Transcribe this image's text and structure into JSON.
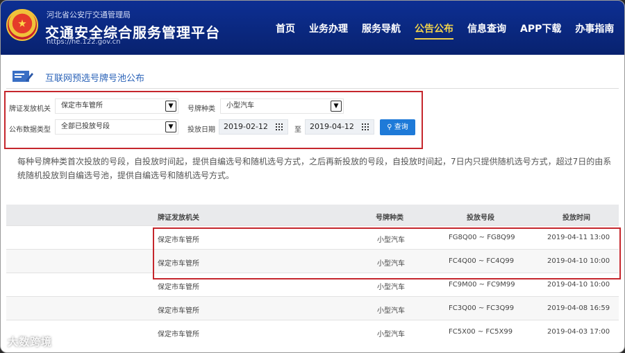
{
  "header": {
    "org_name": "河北省公安厅交通管理局",
    "site_title": "交通安全综合服务管理平台",
    "site_url": "https://he.122.gov.cn",
    "nav": [
      "首页",
      "业务办理",
      "服务导航",
      "公告公布",
      "信息查询",
      "APP下载",
      "办事指南"
    ],
    "active_nav_index": 3,
    "colors": {
      "header_bg": "#0b2a86",
      "active_nav": "#f1d24b"
    }
  },
  "section": {
    "title": "互联网预选号牌号池公布",
    "icon": "form-icon"
  },
  "filters": {
    "authority_label": "牌证发放机关",
    "authority_value": "保定市车管所",
    "plate_type_label": "号牌种类",
    "plate_type_value": "小型汽车",
    "data_type_label": "公布数据类型",
    "data_type_value": "全部已投放号段",
    "date_label": "投放日期",
    "date_from": "2019-02-12",
    "date_sep": "至",
    "date_to": "2019-04-12",
    "query_button": "查询",
    "highlight_color": "#c5262c",
    "button_color": "#1e7ad8"
  },
  "notice": "每种号牌种类首次投放的号段，自投放时间起，提供自编选号和随机选号方式，之后再新投放的号段，自投放时间起，7日内只提供随机选号方式，超过7日的由系统随机投放到自编选号池，提供自编选号和随机选号方式。",
  "table": {
    "headers": [
      "牌证发放机关",
      "号牌种类",
      "投放号段",
      "投放时间"
    ],
    "rows": [
      [
        "保定市车管所",
        "小型汽车",
        "FG8Q00 ~ FG8Q99",
        "2019-04-11 13:00"
      ],
      [
        "保定市车管所",
        "小型汽车",
        "FC4Q00 ~ FC4Q99",
        "2019-04-10 10:00"
      ],
      [
        "保定市车管所",
        "小型汽车",
        "FC9M00 ~ FC9M99",
        "2019-04-10 10:00"
      ],
      [
        "保定市车管所",
        "小型汽车",
        "FC3Q00 ~ FC3Q99",
        "2019-04-08 16:59"
      ],
      [
        "保定市车管所",
        "小型汽车",
        "FC5X00 ~ FC5X99",
        "2019-04-03 17:00"
      ]
    ]
  },
  "watermark": "大数跨境"
}
